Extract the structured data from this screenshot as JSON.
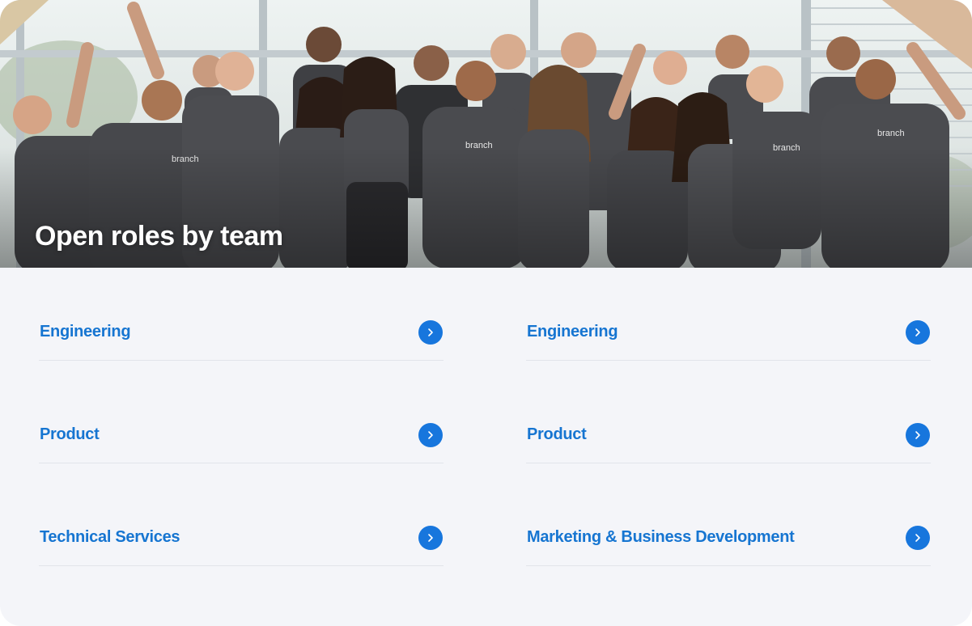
{
  "hero": {
    "title": "Open roles by team",
    "photo_text": "branch"
  },
  "roles": {
    "left": [
      {
        "label": "Engineering",
        "icon": "chevron-right-icon"
      },
      {
        "label": "Product",
        "icon": "chevron-right-icon"
      },
      {
        "label": "Technical Services",
        "icon": "chevron-right-icon"
      }
    ],
    "right": [
      {
        "label": "Engineering",
        "icon": "chevron-right-icon"
      },
      {
        "label": "Product",
        "icon": "chevron-right-icon"
      },
      {
        "label": "Marketing & Business Development",
        "icon": "chevron-right-icon"
      }
    ]
  },
  "colors": {
    "accent": "#1776dd",
    "link": "#1675d1",
    "background": "#f4f5f9",
    "divider": "#e1e4ea",
    "shirt": "#4a4b4f"
  }
}
